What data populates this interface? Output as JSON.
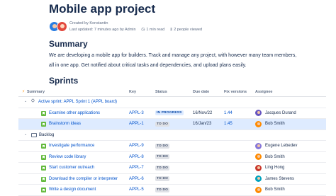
{
  "page": {
    "title": "Mobile app project",
    "meta_created": "Created by Konstantin",
    "meta_updated": "Last updated: 7 minutes ago by Admin",
    "meta_read": "1 min read",
    "meta_viewed": "2 people viewed"
  },
  "summary": {
    "heading": "Summary",
    "text": "We are developing a mobile app for builders. Track and manage any project, with however many team members, all in one app. Get notified about critical tasks and dependencies, and upload plans easily."
  },
  "sprints": {
    "heading": "Sprints",
    "columns": [
      "Summary",
      "Key",
      "Status",
      "Due date",
      "Fix versions",
      "Assignee"
    ],
    "groups": [
      {
        "label": "Active sprint: APPL Sprint 1 (APPL board)",
        "rows": [
          {
            "summary": "Examine other applications",
            "key": "APPL-3",
            "status": "IN PROGRESS",
            "due": "16/Nov/22",
            "fix": "1.44",
            "assignee": "Jacques Durand",
            "avatar_color": "#6554c0"
          },
          {
            "summary": "Brainstorm ideas",
            "key": "APPL-1",
            "status": "TO DO",
            "due": "16/Jan/23",
            "fix": "1.45",
            "assignee": "Bob Smith",
            "avatar_color": "#ff8b00"
          }
        ]
      },
      {
        "label": "Backlog",
        "rows": [
          {
            "summary": "Investigate performance",
            "key": "APPL-9",
            "status": "TO DO",
            "due": "",
            "fix": "",
            "assignee": "Eugene Lebedev",
            "avatar_color": "#8777d9"
          },
          {
            "summary": "Review code library",
            "key": "APPL-8",
            "status": "TO DO",
            "due": "",
            "fix": "",
            "assignee": "Bob Smith",
            "avatar_color": "#ff8b00"
          },
          {
            "summary": "Start customer outreach",
            "key": "APPL-7",
            "status": "TO DO",
            "due": "",
            "fix": "",
            "assignee": "Ling Hong",
            "avatar_color": "#c9372c"
          },
          {
            "summary": "Download the compiler or interpreter",
            "key": "APPL-6",
            "status": "TO DO",
            "due": "",
            "fix": "",
            "assignee": "James Stevens",
            "avatar_color": "#00a3bf"
          },
          {
            "summary": "Write a design document",
            "key": "APPL-5",
            "status": "TO DO",
            "due": "",
            "fix": "",
            "assignee": "Bob Smith",
            "avatar_color": "#ff8b00"
          }
        ]
      }
    ]
  }
}
